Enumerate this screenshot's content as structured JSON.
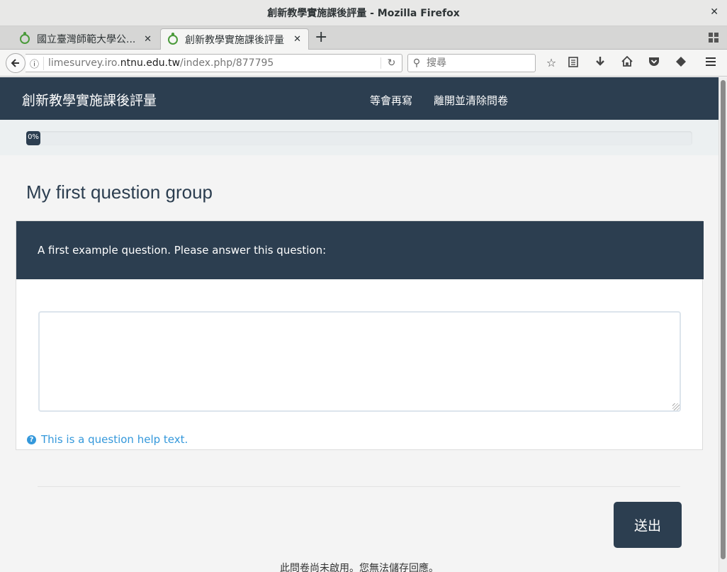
{
  "window": {
    "title": "創新教學實施課後評量 - Mozilla Firefox",
    "close_glyph": "✕"
  },
  "tabs": [
    {
      "label": "國立臺灣師範大學公...",
      "close": "✕"
    },
    {
      "label": "創新教學實施課後評量",
      "close": "✕"
    }
  ],
  "new_tab_glyph": "+",
  "nav": {
    "url_host_prefix": "limesurvey.iro.",
    "url_host_main": "ntnu.edu.tw",
    "url_path": "/index.php/877795",
    "search_placeholder": "搜尋"
  },
  "icons": {
    "back": "arrow-left-icon",
    "info": "info-icon",
    "reload": "reload-icon",
    "search": "search-icon",
    "bookmark": "star-icon",
    "reader": "clipboard-icon",
    "download": "download-icon",
    "home": "home-icon",
    "pocket": "pocket-icon",
    "extension": "extension-icon",
    "menu": "hamburger-menu-icon",
    "help": "question-circle-icon"
  },
  "survey": {
    "title": "創新教學實施課後評量",
    "header_links": {
      "resume_later": "等會再寫",
      "exit_clear": "離開並清除問卷"
    },
    "progress": {
      "value": 0,
      "label": "0%"
    },
    "group_title": "My first question group",
    "question_text": "A first example question. Please answer this question:",
    "answer_value": "",
    "help_text": "This is a question help text.",
    "submit_label": "送出",
    "notice": "此問卷尚未啟用。您無法儲存回應。"
  },
  "colors": {
    "header_bg": "#2c3e50",
    "link_blue": "#3498db",
    "page_bg": "#f4f4f4"
  }
}
